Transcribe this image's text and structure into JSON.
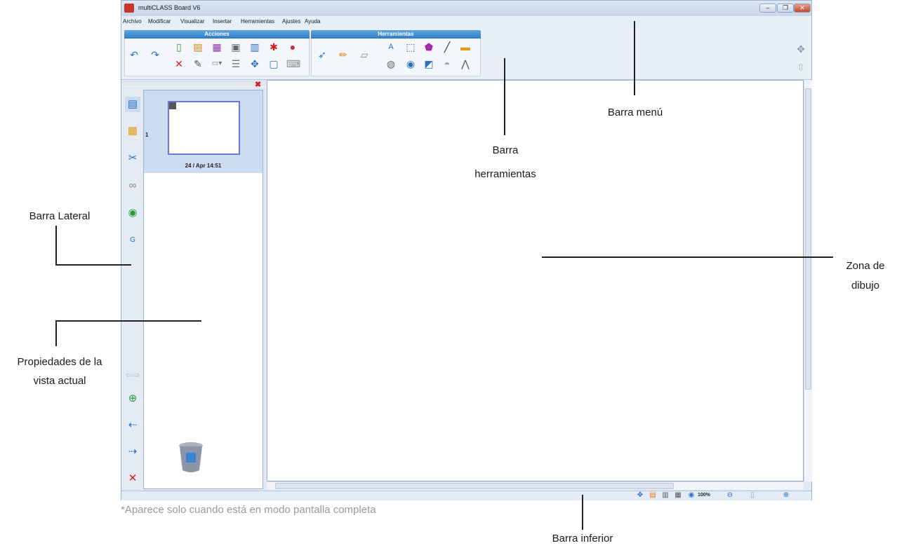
{
  "window": {
    "title": "multiCLASS Board V6"
  },
  "menu": {
    "items": [
      "Archivo",
      "Modificar",
      "Visualizar",
      "Insertar",
      "Herramientas",
      "Ajustes",
      "Ayuda"
    ]
  },
  "toolbar": {
    "groups": [
      {
        "label": "Acciones"
      },
      {
        "label": "Herramientas"
      }
    ]
  },
  "pages_panel": {
    "page_number": "1",
    "timestamp": "24 / Apr 14:51"
  },
  "status_bar": {
    "zoom": "100%"
  },
  "annotations": {
    "menu_bar": "Barra menú",
    "tools_bar_line1": "Barra",
    "tools_bar_line2": "herramientas",
    "sidebar": "Barra Lateral",
    "drawing_zone_line1": "Zona de",
    "drawing_zone_line2": "dibujo",
    "view_props_line1": "Propiedades de la",
    "view_props_line2": "vista actual",
    "bottom_bar": "Barra inferior",
    "footnote": "*Aparece solo cuando está en modo pantalla completa"
  },
  "colors": {
    "accent": "#2f7bc4",
    "window_bg": "#dfe8f3",
    "thumb_border": "#6e78d8",
    "close_red": "#d12020"
  }
}
